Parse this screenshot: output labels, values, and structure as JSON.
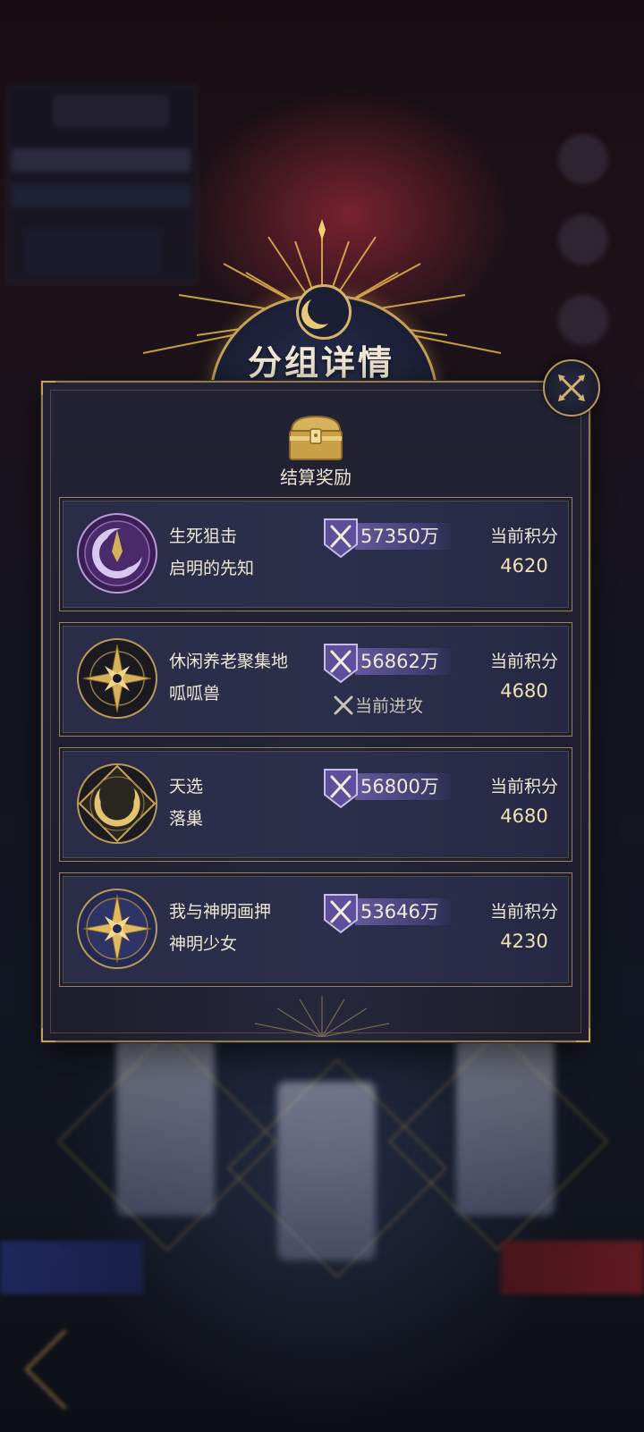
{
  "dialog": {
    "title": "分组详情",
    "reward_label": "结算奖励"
  },
  "groups": [
    {
      "guild": "生死狙击",
      "leader": "启明的先知",
      "power": "57350万",
      "score_label": "当前积分",
      "score": "4620",
      "attack_status": "",
      "emblem": "crescent-purple"
    },
    {
      "guild": "休闲养老聚集地",
      "leader": "呱呱兽",
      "power": "56862万",
      "score_label": "当前积分",
      "score": "4680",
      "attack_status": "当前进攻",
      "emblem": "compass-dark"
    },
    {
      "guild": "天选",
      "leader": "落巢",
      "power": "56800万",
      "score_label": "当前积分",
      "score": "4680",
      "attack_status": "",
      "emblem": "crescent-gold"
    },
    {
      "guild": "我与神明画押",
      "leader": "神明少女",
      "power": "53646万",
      "score_label": "当前积分",
      "score": "4230",
      "attack_status": "",
      "emblem": "compass-blue"
    }
  ],
  "colors": {
    "gold": "#c6a058",
    "panel": "#1d1d2c",
    "row": "#2a2c48",
    "power_shield": "#5e4f9a",
    "score": "#efe1b0"
  }
}
